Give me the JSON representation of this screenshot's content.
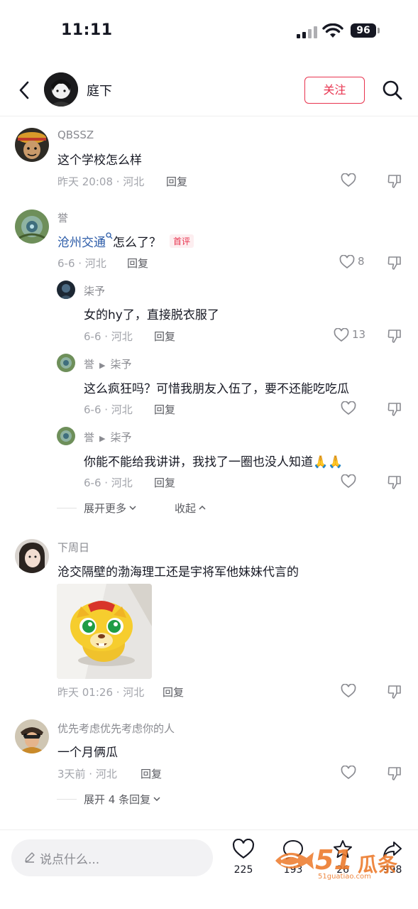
{
  "status_bar": {
    "time": "11:11",
    "battery": "96"
  },
  "header": {
    "username": "庭下",
    "follow_label": "关注"
  },
  "comments": [
    {
      "username": "QBSSZ",
      "text": "这个学校怎么样",
      "meta": "昨天 20:08 · 河北",
      "reply_label": "回复",
      "likes": ""
    },
    {
      "username": "誉",
      "link_text": "沧州交通",
      "text": "怎么了？",
      "tag": "首评",
      "meta": "6-6 · 河北",
      "reply_label": "回复",
      "likes": "8",
      "replies": [
        {
          "username": "柒予",
          "reply_to": "",
          "text": "女的hy了，直接脱衣服了",
          "meta": "6-6 · 河北",
          "reply_label": "回复",
          "likes": "13"
        },
        {
          "username": "誉",
          "reply_to": "柒予",
          "text": "这么疯狂吗？可惜我朋友入伍了，要不还能吃吃瓜",
          "meta": "6-6 · 河北",
          "reply_label": "回复",
          "likes": ""
        },
        {
          "username": "誉",
          "reply_to": "柒予",
          "text": "你能不能给我讲讲，我找了一圈也没人知道🙏🙏",
          "meta": "6-6 · 河北",
          "reply_label": "回复",
          "likes": ""
        }
      ],
      "expand_more": "展开更多",
      "collapse": "收起"
    },
    {
      "username": "下周日",
      "text": "沧交隔壁的渤海理工还是宇将军他妹妹代言的",
      "meta": "昨天 01:26 · 河北",
      "reply_label": "回复",
      "likes": ""
    },
    {
      "username": "优先考虑优先考虑你的人",
      "text": "一个月俩瓜",
      "meta": "3天前 · 河北",
      "reply_label": "回复",
      "likes": "",
      "expand_label": "展开 4 条回复"
    }
  ],
  "bottom_bar": {
    "placeholder": "说点什么...",
    "like_count": "225",
    "comment_count": "193",
    "star_count": "26",
    "share_count": "998"
  },
  "watermark": {
    "brand": "51",
    "brand_cn": "瓜条",
    "url": "51guatiao.com"
  },
  "colors": {
    "accent": "#e8344f",
    "link": "#2b5ba8",
    "meta": "#a1a3aa"
  }
}
